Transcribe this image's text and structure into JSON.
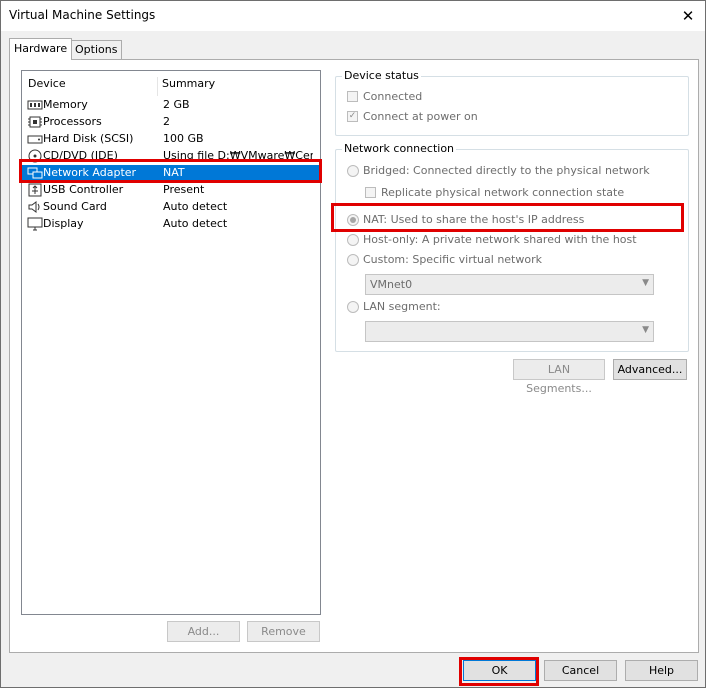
{
  "window": {
    "title": "Virtual Machine Settings",
    "close_glyph": "✕"
  },
  "tabs": [
    {
      "label": "Hardware",
      "active": true
    },
    {
      "label": "Options",
      "active": false
    }
  ],
  "device_list": {
    "columns": {
      "device": "Device",
      "summary": "Summary"
    },
    "rows": [
      {
        "name": "Memory",
        "summary": "2 GB",
        "icon": "memory-icon"
      },
      {
        "name": "Processors",
        "summary": "2",
        "icon": "processor-icon"
      },
      {
        "name": "Hard Disk (SCSI)",
        "summary": "100 GB",
        "icon": "hard-disk-icon"
      },
      {
        "name": "CD/DVD (IDE)",
        "summary": "Using file D:₩VMware₩Cen...",
        "icon": "cd-dvd-icon"
      },
      {
        "name": "Network Adapter",
        "summary": "NAT",
        "icon": "network-adapter-icon",
        "selected": true
      },
      {
        "name": "USB Controller",
        "summary": "Present",
        "icon": "usb-icon"
      },
      {
        "name": "Sound Card",
        "summary": "Auto detect",
        "icon": "sound-icon"
      },
      {
        "name": "Display",
        "summary": "Auto detect",
        "icon": "display-icon"
      }
    ],
    "add_label": "Add...",
    "remove_label": "Remove"
  },
  "device_status": {
    "title": "Device status",
    "connected": {
      "label": "Connected",
      "checked": false
    },
    "connect_at_power_on": {
      "label": "Connect at power on",
      "checked": true
    }
  },
  "network_connection": {
    "title": "Network connection",
    "bridged": "Bridged: Connected directly to the physical network",
    "replicate": "Replicate physical network connection state",
    "nat": "NAT: Used to share the host's IP address",
    "host_only": "Host-only: A private network shared with the host",
    "custom": "Custom: Specific virtual network",
    "custom_value": "VMnet0",
    "lan_segment": "LAN segment:",
    "lan_value": "",
    "selected": "nat"
  },
  "buttons": {
    "lan_segments": "LAN Segments...",
    "advanced": "Advanced...",
    "ok": "OK",
    "cancel": "Cancel",
    "help": "Help"
  },
  "colors": {
    "selection": "#0078d7",
    "highlight": "#e00000"
  }
}
